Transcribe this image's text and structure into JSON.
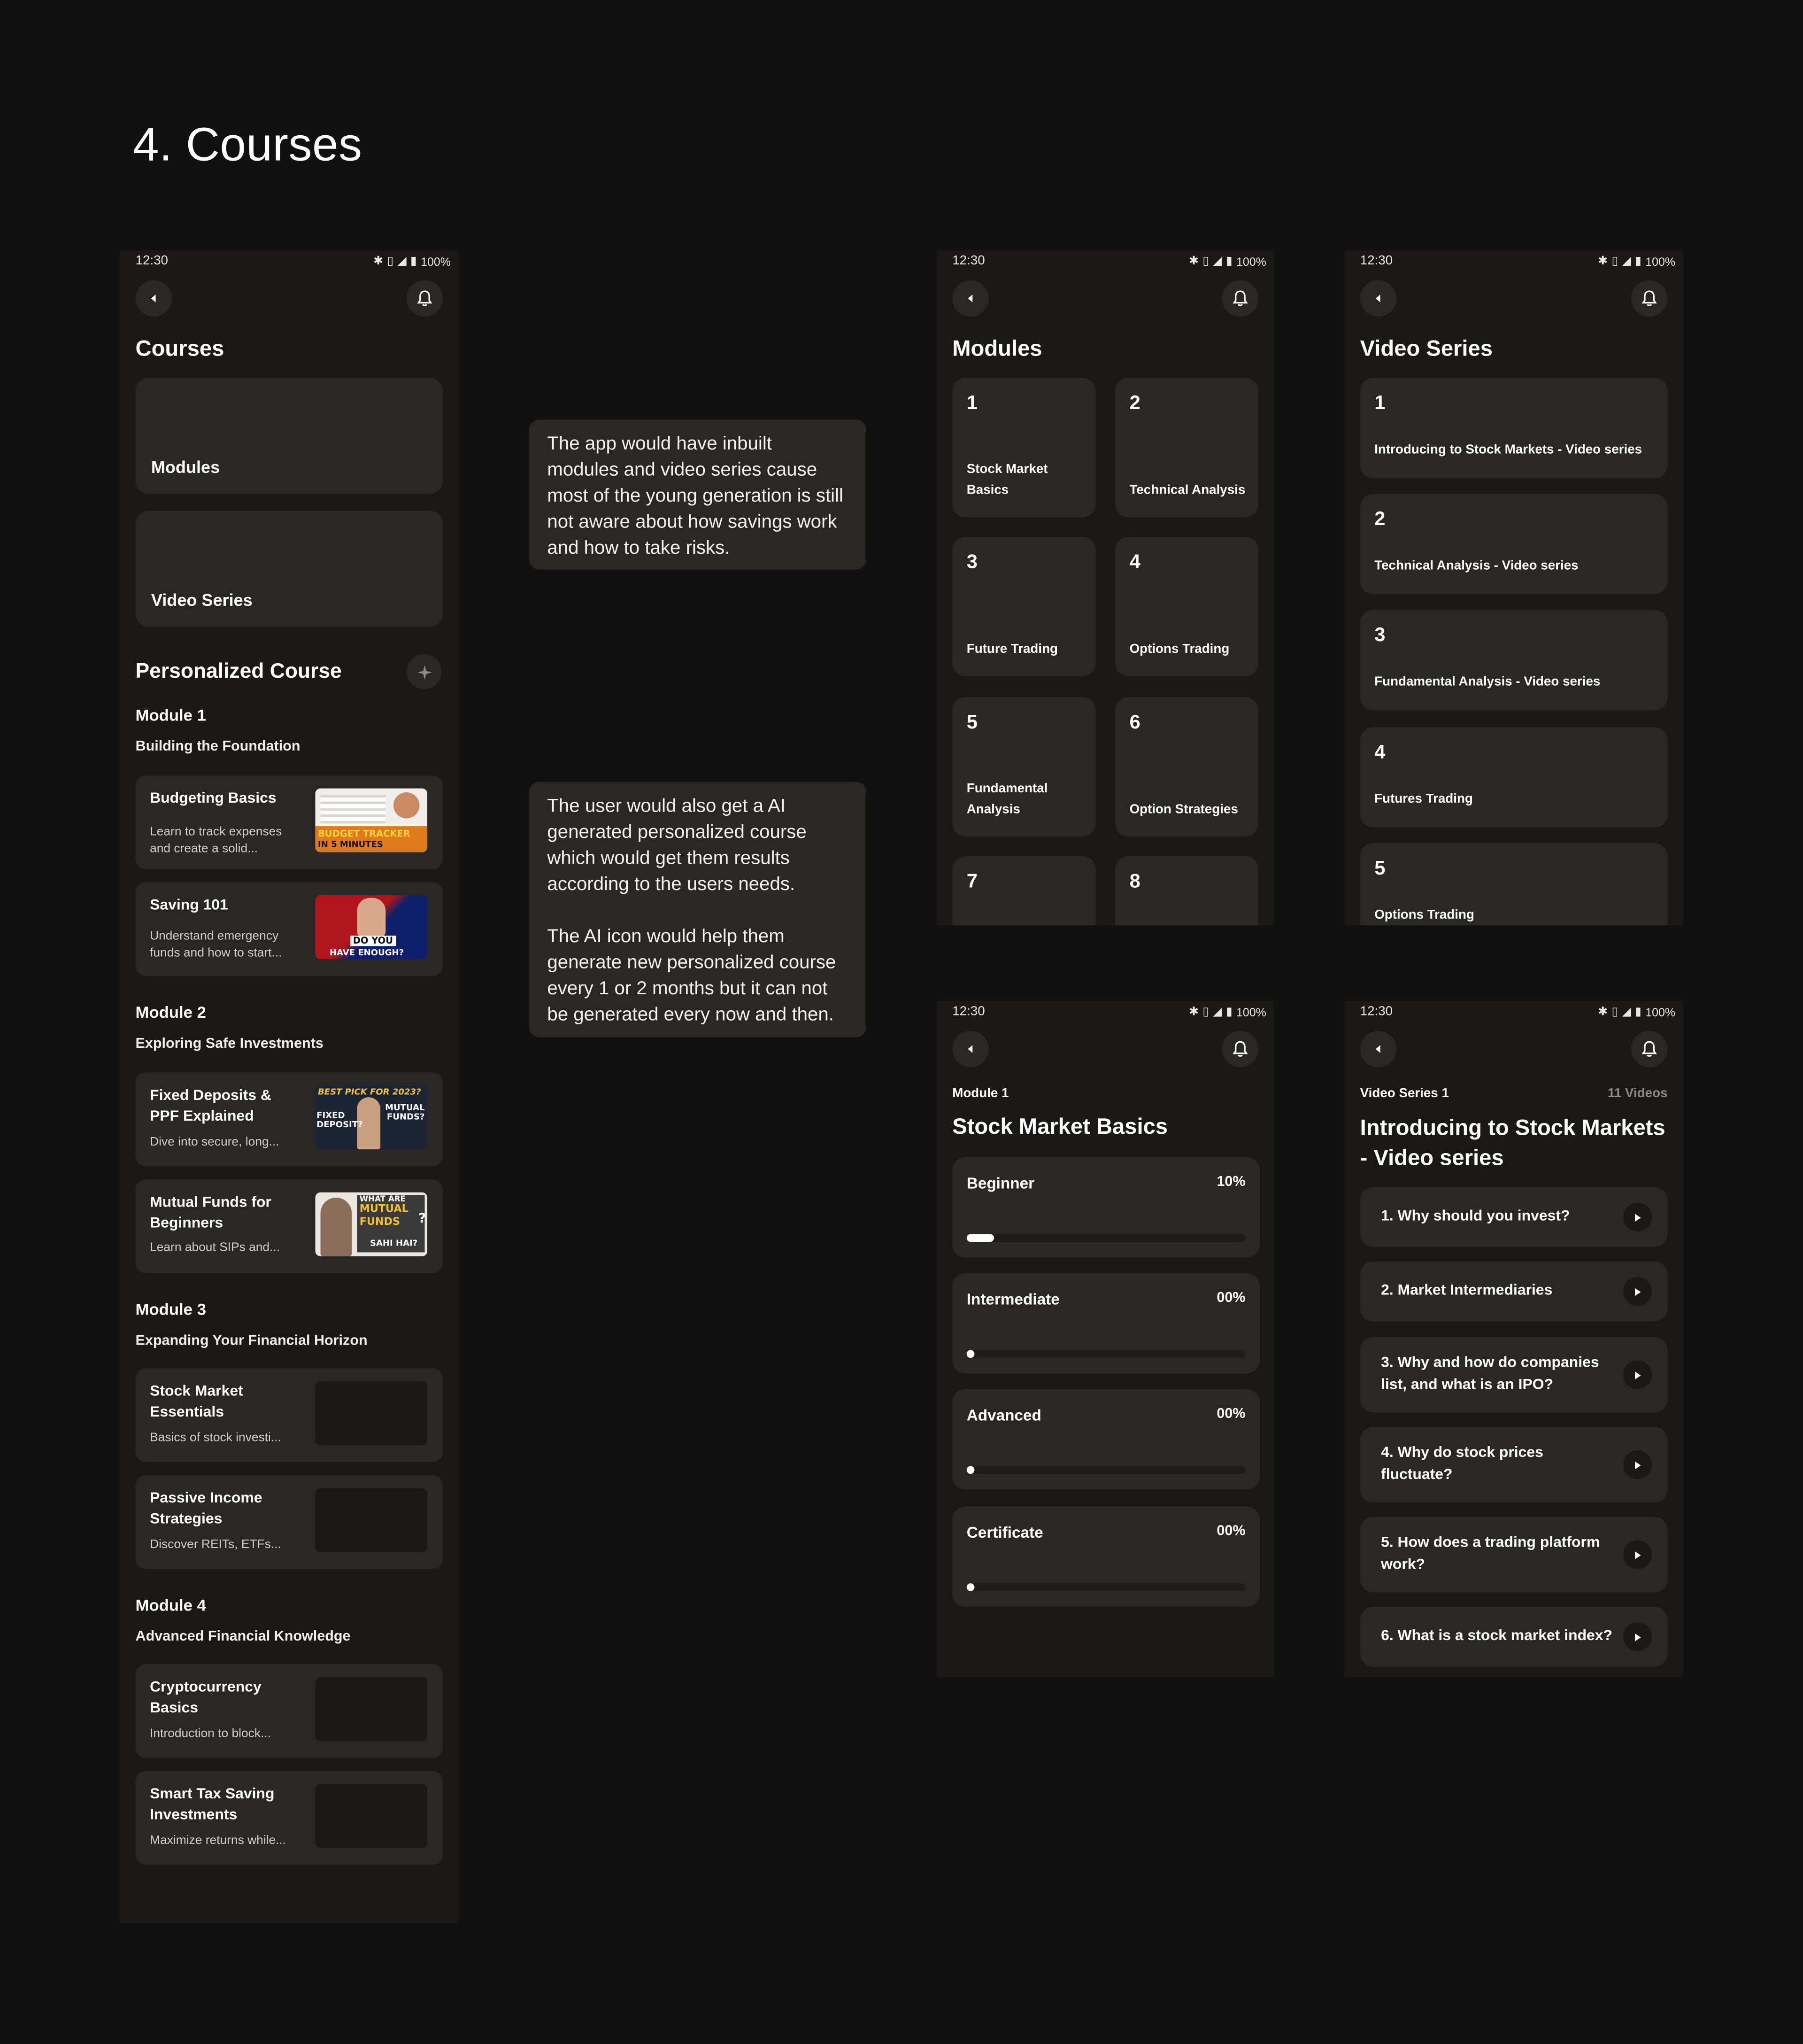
{
  "page_title": "4. Courses",
  "status": {
    "time": "12:30",
    "battery": "100%"
  },
  "courses_screen": {
    "title": "Courses",
    "cards": [
      "Modules",
      "Video Series"
    ],
    "personalized_title": "Personalized Course",
    "modules": [
      {
        "label": "Module 1",
        "subtitle": "Building the Foundation",
        "lessons": [
          {
            "title": "Budgeting Basics",
            "desc": "Learn to track expenses and create a solid...",
            "thumb_text": [
              "BUDGET TRACKER",
              "IN 5 MINUTES"
            ]
          },
          {
            "title": "Saving 101",
            "desc": "Understand emergency funds and how to start...",
            "thumb_text": [
              "DO YOU",
              "HAVE ENOUGH?"
            ]
          }
        ]
      },
      {
        "label": "Module 2",
        "subtitle": "Exploring Safe Investments",
        "lessons": [
          {
            "title": "Fixed Deposits & PPF Explained",
            "desc": "Dive into secure, long...",
            "thumb_text": [
              "BEST PICK FOR 2023?",
              "FIXED DEPOSIT?",
              "MUTUAL FUNDS?"
            ]
          },
          {
            "title": "Mutual Funds for Beginners",
            "desc": "Learn about SIPs and...",
            "thumb_text": [
              "WHAT ARE",
              "MUTUAL FUNDS",
              "?",
              "SAHI HAI?"
            ]
          }
        ]
      },
      {
        "label": "Module 3",
        "subtitle": "Expanding Your Financial Horizon",
        "lessons": [
          {
            "title": "Stock Market Essentials",
            "desc": "Basics of stock investi..."
          },
          {
            "title": "Passive Income Strategies",
            "desc": "Discover REITs, ETFs..."
          }
        ]
      },
      {
        "label": "Module 4",
        "subtitle": "Advanced Financial Knowledge",
        "lessons": [
          {
            "title": "Cryptocurrency Basics",
            "desc": "Introduction to block..."
          },
          {
            "title": "Smart Tax Saving Investments",
            "desc": "Maximize returns while..."
          }
        ]
      }
    ]
  },
  "notes": {
    "note1": "The app would have inbuilt modules and video series cause most of the young generation is still not aware about how savings work and how to take risks.",
    "note2a": "The user would also get a AI generated personalized course which would get them results according to the users needs.",
    "note2b": "The AI icon would help them generate new personalized course every 1 or 2 months but it can not be generated every now and then."
  },
  "modules_screen": {
    "title": "Modules",
    "items": [
      {
        "num": "1",
        "name": "Stock Market Basics"
      },
      {
        "num": "2",
        "name": "Technical Analysis"
      },
      {
        "num": "3",
        "name": "Future Trading"
      },
      {
        "num": "4",
        "name": "Options Trading"
      },
      {
        "num": "5",
        "name": "Fundamental Analysis"
      },
      {
        "num": "6",
        "name": "Option Strategies"
      },
      {
        "num": "7",
        "name": ""
      },
      {
        "num": "8",
        "name": ""
      }
    ]
  },
  "video_series_screen": {
    "title": "Video Series",
    "items": [
      {
        "num": "1",
        "name": "Introducing to Stock Markets - Video series"
      },
      {
        "num": "2",
        "name": "Technical Analysis - Video series"
      },
      {
        "num": "3",
        "name": "Fundamental Analysis - Video series"
      },
      {
        "num": "4",
        "name": "Futures Trading"
      },
      {
        "num": "5",
        "name": "Options Trading"
      }
    ]
  },
  "module_detail": {
    "eyebrow": "Module 1",
    "title": "Stock Market Basics",
    "levels": [
      {
        "label": "Beginner",
        "value": "10%",
        "progress": 0.1
      },
      {
        "label": "Intermediate",
        "value": "00%",
        "progress": 0
      },
      {
        "label": "Advanced",
        "value": "00%",
        "progress": 0
      },
      {
        "label": "Certificate",
        "value": "00%",
        "progress": 0
      }
    ]
  },
  "series_detail": {
    "eyebrow": "Video Series 1",
    "count": "11 Videos",
    "title": "Introducing to Stock Markets - Video series",
    "episodes": [
      "1. Why should you invest?",
      "2. Market Intermediaries",
      "3. Why and how do companies list, and what is an IPO?",
      "4. Why do stock prices fluctuate?",
      "5. How does a trading platform work?",
      "6. What is a stock market index?"
    ]
  },
  "colors": {
    "background": "#121112",
    "phone": "#1b1918",
    "card": "#2a2827",
    "text": "#ffffff"
  }
}
